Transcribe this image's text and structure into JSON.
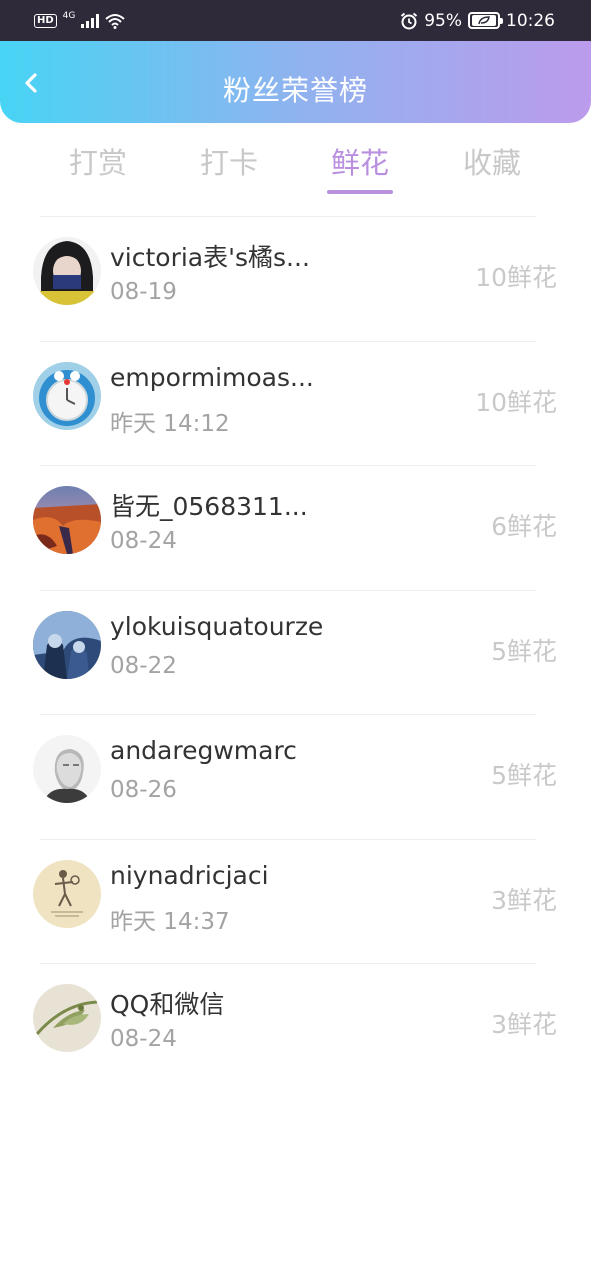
{
  "status_bar": {
    "hd": "HD",
    "network": "4G",
    "battery": "95%",
    "time": "10:26",
    "icons": [
      "hd-icon",
      "signal-icon",
      "wifi-icon",
      "alarm-icon",
      "battery-icon"
    ]
  },
  "header": {
    "title": "粉丝荣誉榜",
    "back_icon": "chevron-left-icon",
    "gradient": [
      "#47d4f4",
      "#bc9bec"
    ]
  },
  "tabs": [
    {
      "label": "打赏",
      "active": false
    },
    {
      "label": "打卡",
      "active": false
    },
    {
      "label": "鲜花",
      "active": true
    },
    {
      "label": "收藏",
      "active": false
    }
  ],
  "accent_color": "#b98fe0",
  "fans": [
    {
      "name": "victoria表's橘s...",
      "time": "08-19",
      "count": "10鲜花"
    },
    {
      "name": "empormimoas...",
      "time": "昨天 14:12",
      "count": "10鲜花"
    },
    {
      "name": "皆无_0568311...",
      "time": "08-24",
      "count": "6鲜花"
    },
    {
      "name": "ylokuisquatourze",
      "time": "08-22",
      "count": "5鲜花"
    },
    {
      "name": "andaregwmarc",
      "time": "08-26",
      "count": "5鲜花"
    },
    {
      "name": "niynadricjaci",
      "time": "昨天 14:37",
      "count": "3鲜花"
    },
    {
      "name": "QQ和微信",
      "time": "08-24",
      "count": "3鲜花"
    }
  ]
}
